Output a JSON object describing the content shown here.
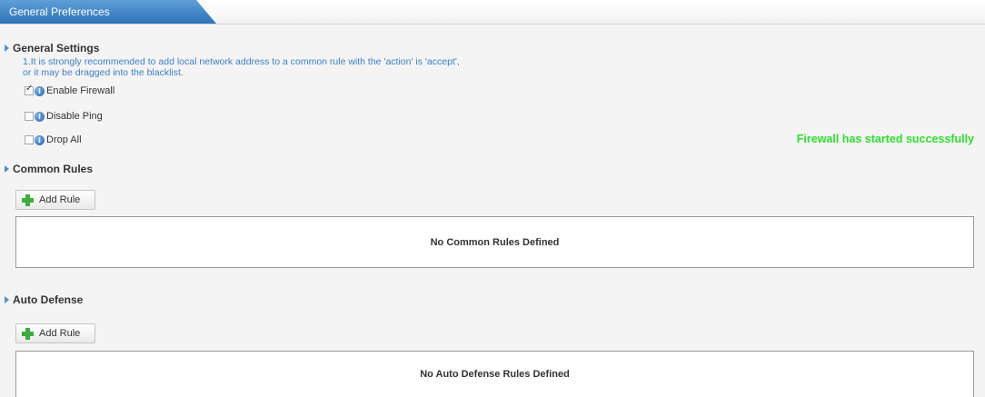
{
  "tab": {
    "label": "General Preferences"
  },
  "general_settings": {
    "title": "General Settings",
    "note_line1": "1.It is strongly recommended to add local network address to a common rule with the 'action' is 'accept',",
    "note_line2": "or it may be dragged into the blacklist.",
    "options": [
      {
        "label": "Enable Firewall",
        "checked": true
      },
      {
        "label": "Disable Ping",
        "checked": false
      },
      {
        "label": "Drop All",
        "checked": false
      }
    ],
    "status": "Firewall has started successfully",
    "status_color": "#2ee02e"
  },
  "common_rules": {
    "title": "Common Rules",
    "add_label": "Add Rule",
    "empty_text": "No Common Rules Defined"
  },
  "auto_defense": {
    "title": "Auto Defense",
    "add_label": "Add Rule",
    "empty_text": "No Auto Defense Rules Defined"
  },
  "icons": {
    "info": "info-icon",
    "add": "plus-icon",
    "section": "triangle-right-icon"
  },
  "colors": {
    "tab": "#3a82c4",
    "link_text": "#3d7fc6",
    "add_icon": "#3cae3c"
  }
}
